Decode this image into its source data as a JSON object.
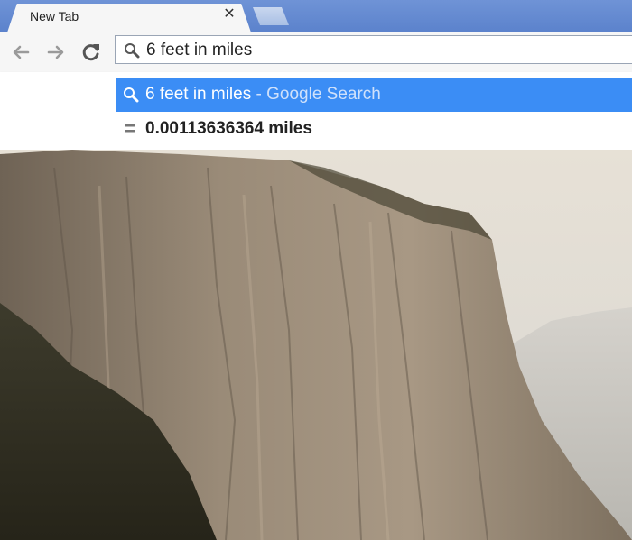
{
  "tab": {
    "title": "New Tab",
    "close_glyph": "✕"
  },
  "toolbar": {
    "back_icon": "back-arrow-icon",
    "forward_icon": "forward-arrow-icon",
    "reload_icon": "reload-icon"
  },
  "omnibox": {
    "value": "6 feet in miles",
    "icon": "search-icon"
  },
  "suggestions": [
    {
      "query": "6 feet in miles",
      "separator": " - ",
      "engine": "Google Search",
      "icon": "search-icon"
    },
    {
      "answer": "0.00113636364 miles",
      "icon": "equals-icon"
    }
  ],
  "colors": {
    "tabstrip": "#5b82cc",
    "selected_suggestion": "#3b8df5"
  }
}
